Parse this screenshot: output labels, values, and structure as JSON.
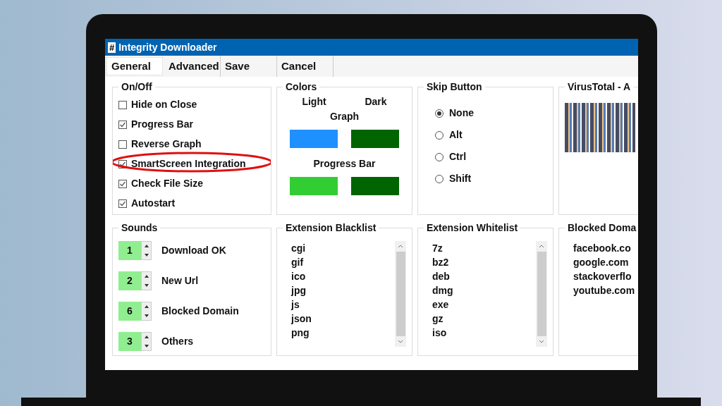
{
  "window": {
    "icon": "#",
    "title": "Integrity Downloader"
  },
  "tabs": [
    {
      "label": "General",
      "selected": true
    },
    {
      "label": "Advanced",
      "selected": false
    },
    {
      "label": "Save",
      "selected": false
    },
    {
      "label": "Cancel",
      "selected": false
    }
  ],
  "on_off": {
    "title": "On/Off",
    "options": [
      {
        "label": "Hide on Close",
        "checked": false,
        "highlighted": false
      },
      {
        "label": "Progress Bar",
        "checked": true,
        "highlighted": false
      },
      {
        "label": "Reverse Graph",
        "checked": false,
        "highlighted": false
      },
      {
        "label": "SmartScreen Integration",
        "checked": true,
        "highlighted": true
      },
      {
        "label": "Check File Size",
        "checked": true,
        "highlighted": false
      },
      {
        "label": "Autostart",
        "checked": true,
        "highlighted": false
      }
    ]
  },
  "colors": {
    "title": "Colors",
    "light_label": "Light",
    "dark_label": "Dark",
    "groups": [
      {
        "label": "Graph",
        "swatches": [
          {
            "color": "#1e90ff"
          },
          {
            "color": "#006400"
          }
        ]
      },
      {
        "label": "Progress Bar",
        "swatches": [
          {
            "color": "#32cd32"
          },
          {
            "color": "#006400"
          }
        ]
      }
    ]
  },
  "skip_button": {
    "title": "Skip Button",
    "options": [
      {
        "label": "None",
        "selected": true
      },
      {
        "label": "Alt",
        "selected": false
      },
      {
        "label": "Ctrl",
        "selected": false
      },
      {
        "label": "Shift",
        "selected": false
      }
    ]
  },
  "virustotal": {
    "title": "VirusTotal - A"
  },
  "sounds": {
    "title": "Sounds",
    "items": [
      {
        "value": "1",
        "label": "Download OK"
      },
      {
        "value": "2",
        "label": "New Url"
      },
      {
        "value": "6",
        "label": "Blocked Domain"
      },
      {
        "value": "3",
        "label": "Others"
      }
    ]
  },
  "extension_blacklist": {
    "title": "Extension Blacklist",
    "items": [
      "cgi",
      "gif",
      "ico",
      "jpg",
      "js",
      "json",
      "png"
    ]
  },
  "extension_whitelist": {
    "title": "Extension Whitelist",
    "items": [
      "7z",
      "bz2",
      "deb",
      "dmg",
      "exe",
      "gz",
      "iso"
    ]
  },
  "blocked_domains": {
    "title": "Blocked Doma",
    "items": [
      "facebook.co",
      "google.com",
      "stackoverflo",
      "youtube.com"
    ]
  }
}
